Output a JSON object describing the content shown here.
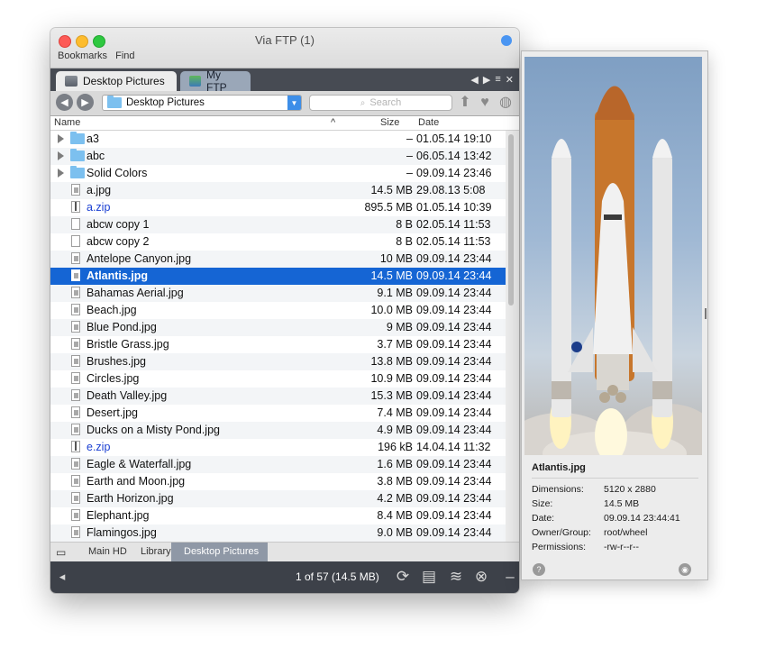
{
  "window": {
    "title": "Via FTP (1)"
  },
  "menu": {
    "items": [
      "Bookmarks",
      "Find"
    ]
  },
  "tabs": [
    {
      "label": "Desktop Pictures",
      "active": true,
      "icon": "drive-icon"
    },
    {
      "label": "My FTP",
      "active": false,
      "icon": "ftp-icon"
    }
  ],
  "tab_controls": {
    "left": "◀",
    "right": "▶",
    "menu": "≡",
    "close": "✕"
  },
  "path_selector": {
    "value": "Desktop Pictures"
  },
  "search": {
    "placeholder": "Search"
  },
  "columns": {
    "name": "Name",
    "size": "Size",
    "date": "Date",
    "sort_indicator": "^"
  },
  "files": [
    {
      "name": "a3",
      "kind": "folder",
      "size": "–",
      "date": "01.05.14 19:10"
    },
    {
      "name": "abc",
      "kind": "folder",
      "size": "–",
      "date": "06.05.14 13:42"
    },
    {
      "name": "Solid Colors",
      "kind": "folder",
      "size": "–",
      "date": "09.09.14 23:46"
    },
    {
      "name": "a.jpg",
      "kind": "image",
      "size": "14.5 MB",
      "date": "29.08.13 5:08"
    },
    {
      "name": "a.zip",
      "kind": "zip",
      "size": "895.5 MB",
      "date": "01.05.14 10:39"
    },
    {
      "name": "abcw copy 1",
      "kind": "doc",
      "size": "8 B",
      "date": "02.05.14 11:53"
    },
    {
      "name": "abcw copy 2",
      "kind": "doc",
      "size": "8 B",
      "date": "02.05.14 11:53"
    },
    {
      "name": "Antelope Canyon.jpg",
      "kind": "image",
      "size": "10 MB",
      "date": "09.09.14 23:44"
    },
    {
      "name": "Atlantis.jpg",
      "kind": "image",
      "size": "14.5 MB",
      "date": "09.09.14 23:44",
      "selected": true
    },
    {
      "name": "Bahamas Aerial.jpg",
      "kind": "image",
      "size": "9.1 MB",
      "date": "09.09.14 23:44"
    },
    {
      "name": "Beach.jpg",
      "kind": "image",
      "size": "10.0 MB",
      "date": "09.09.14 23:44"
    },
    {
      "name": "Blue Pond.jpg",
      "kind": "image",
      "size": "9 MB",
      "date": "09.09.14 23:44"
    },
    {
      "name": "Bristle Grass.jpg",
      "kind": "image",
      "size": "3.7 MB",
      "date": "09.09.14 23:44"
    },
    {
      "name": "Brushes.jpg",
      "kind": "image",
      "size": "13.8 MB",
      "date": "09.09.14 23:44"
    },
    {
      "name": "Circles.jpg",
      "kind": "image",
      "size": "10.9 MB",
      "date": "09.09.14 23:44"
    },
    {
      "name": "Death Valley.jpg",
      "kind": "image",
      "size": "15.3 MB",
      "date": "09.09.14 23:44"
    },
    {
      "name": "Desert.jpg",
      "kind": "image",
      "size": "7.4 MB",
      "date": "09.09.14 23:44"
    },
    {
      "name": "Ducks on a Misty Pond.jpg",
      "kind": "image",
      "size": "4.9 MB",
      "date": "09.09.14 23:44"
    },
    {
      "name": "e.zip",
      "kind": "zip",
      "size": "196 kB",
      "date": "14.04.14 11:32"
    },
    {
      "name": "Eagle & Waterfall.jpg",
      "kind": "image",
      "size": "1.6 MB",
      "date": "09.09.14 23:44"
    },
    {
      "name": "Earth and Moon.jpg",
      "kind": "image",
      "size": "3.8 MB",
      "date": "09.09.14 23:44"
    },
    {
      "name": "Earth Horizon.jpg",
      "kind": "image",
      "size": "4.2 MB",
      "date": "09.09.14 23:44"
    },
    {
      "name": "Elephant.jpg",
      "kind": "image",
      "size": "8.4 MB",
      "date": "09.09.14 23:44"
    },
    {
      "name": "Flamingos.jpg",
      "kind": "image",
      "size": "9.0 MB",
      "date": "09.09.14 23:44"
    }
  ],
  "breadcrumb": [
    "Main HD",
    "Library",
    "Desktop Pictures"
  ],
  "status": {
    "text": "1 of 57 (14.5 MB)"
  },
  "inspector": {
    "file_name": "Atlantis.jpg",
    "fields": [
      {
        "key": "Dimensions:",
        "value": "5120 x 2880"
      },
      {
        "key": "Size:",
        "value": "14.5 MB"
      },
      {
        "key": "Date:",
        "value": "09.09.14 23:44:41"
      },
      {
        "key": "Owner/Group:",
        "value": "root/wheel"
      },
      {
        "key": "Permissions:",
        "value": "-rw-r--r--"
      }
    ]
  },
  "colors": {
    "selection": "#1565d4",
    "folder": "#7cc0ef",
    "link": "#1a3fd2",
    "toolbar_dark": "#474b53"
  }
}
